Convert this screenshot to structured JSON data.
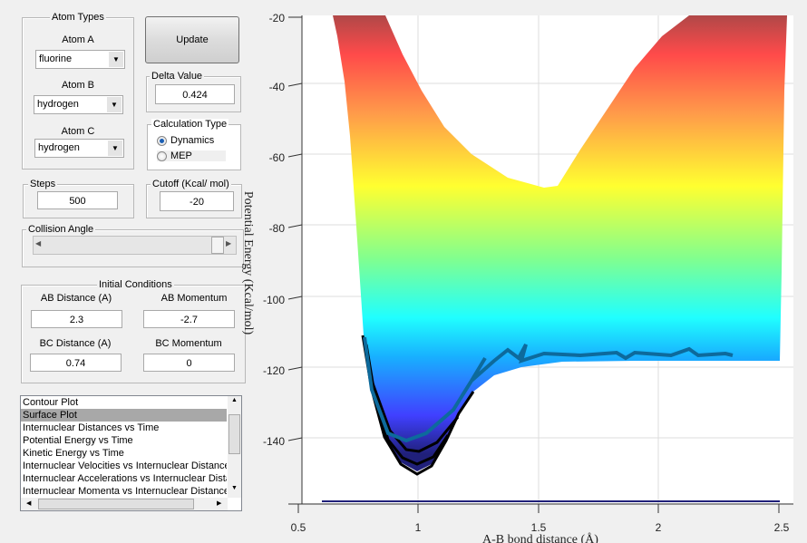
{
  "atom_types": {
    "title": "Atom Types",
    "atom_a": {
      "label": "Atom A",
      "value": "fluorine"
    },
    "atom_b": {
      "label": "Atom B",
      "value": "hydrogen"
    },
    "atom_c": {
      "label": "Atom C",
      "value": "hydrogen"
    }
  },
  "update_label": "Update",
  "delta": {
    "title": "Delta Value",
    "value": "0.424"
  },
  "calc_type": {
    "title": "Calculation Type",
    "options": [
      "Dynamics",
      "MEP"
    ],
    "selected": "Dynamics"
  },
  "steps": {
    "title": "Steps",
    "value": "500"
  },
  "cutoff": {
    "title": "Cutoff (Kcal/ mol)",
    "value": "-20"
  },
  "collision": {
    "title": "Collision Angle",
    "slider_fraction": 1.0
  },
  "initial": {
    "title": "Initial Conditions",
    "ab_dist": {
      "label": "AB Distance (A)",
      "value": "2.3"
    },
    "ab_mom": {
      "label": "AB Momentum",
      "value": "-2.7"
    },
    "bc_dist": {
      "label": "BC Distance (A)",
      "value": "0.74"
    },
    "bc_mom": {
      "label": "BC Momentum",
      "value": "0"
    }
  },
  "plot_list": {
    "items": [
      "Contour Plot",
      "Surface Plot",
      "Internuclear Distances vs Time",
      "Potential Energy vs Time",
      "Kinetic Energy vs Time",
      "Internuclear Velocities vs Internuclear Distance",
      "Internuclear Accelerations vs Internuclear Distance",
      "Internuclear Momenta vs Internuclear Distance"
    ],
    "selected": "Surface Plot"
  },
  "plot": {
    "xlabel": "A-B bond distance (Å)",
    "ylabel": "Potential Energy (Kcal/mol)",
    "xticks": [
      "0.5",
      "1",
      "1.5",
      "2",
      "2.5"
    ],
    "yticks": [
      "-20",
      "-40",
      "-60",
      "-80",
      "-100",
      "-120",
      "-140"
    ],
    "xlim": [
      0.5,
      2.5
    ],
    "ylim": [
      -140,
      -20
    ],
    "colormap": "jet"
  }
}
